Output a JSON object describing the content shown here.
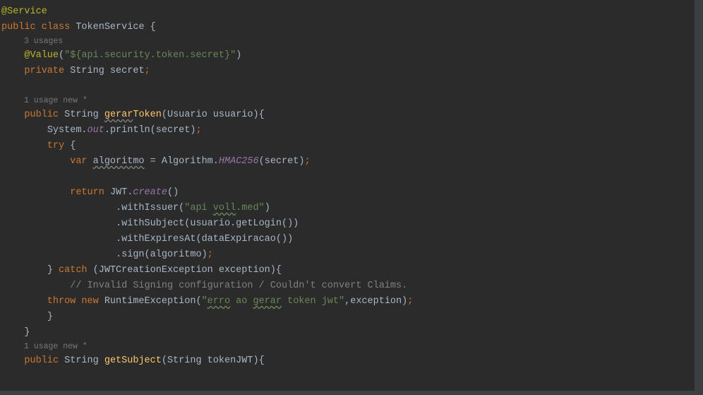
{
  "hints": {
    "usages3": "3 usages",
    "usage1": "1 usage   new *",
    "usage1b": "1 usage   new *"
  },
  "tokens": {
    "atService": "@Service",
    "public": "public ",
    "class_": "class ",
    "TokenService": "TokenService ",
    "lbrace": "{",
    "atValue": "@Value",
    "valueLParen": "(",
    "valueString": "\"${api.security.token.secret}\"",
    "valueRParen": ")",
    "private": "private ",
    "String": "String ",
    "secret": "secret",
    "gerarToken": "gerarToken",
    "gerar_u": "gerar",
    "Token_t": "Token",
    "lparen": "(",
    "Usuario": "Usuario ",
    "usuarioParam": "usuario",
    "rparenBrace": "){",
    "System": "System",
    "dot": ".",
    "out": "out",
    "println": ".println(",
    "secretArg": "secret",
    "rparenSemi": ")",
    "try_": "try ",
    "lbrace2": "{",
    "var_": "var ",
    "algoritmo": "algoritmo",
    "eq": " = ",
    "Algorithm": "Algorithm",
    "HMAC256": "HMAC256",
    "return_": "return ",
    "JWT": "JWT",
    "create": "create",
    "unit": "()",
    "withIssuer": ".withIssuer(",
    "apiVoll_pre": "\"api ",
    "voll_u": "voll",
    "apiVoll_post": ".med\"",
    "close1": ")",
    "withSubject": ".withSubject(",
    "usuarioGetLogin": "usuario.getLogin())",
    "withExpiresAt": ".withExpiresAt(",
    "dataExpiracao": "dataExpiracao())",
    "sign": ".sign(",
    "algoArg": "algoritmo",
    "rbrace": "} ",
    "catch_": "catch ",
    "catchArgs": "(JWTCreationException exception){",
    "comment": "// Invalid Signing configuration / Couldn't convert Claims.",
    "throw_": "throw ",
    "new_": "new ",
    "RuntimeException": "RuntimeException(",
    "erro_q": "\"",
    "erro_u": "erro",
    "erro_mid1": " ao ",
    "gerar_u2": "gerar",
    "erro_mid2": " token jwt\"",
    "commaException": ",exception)",
    "getSubject": "getSubject",
    "tokenJWT": "(String tokenJWT){"
  }
}
